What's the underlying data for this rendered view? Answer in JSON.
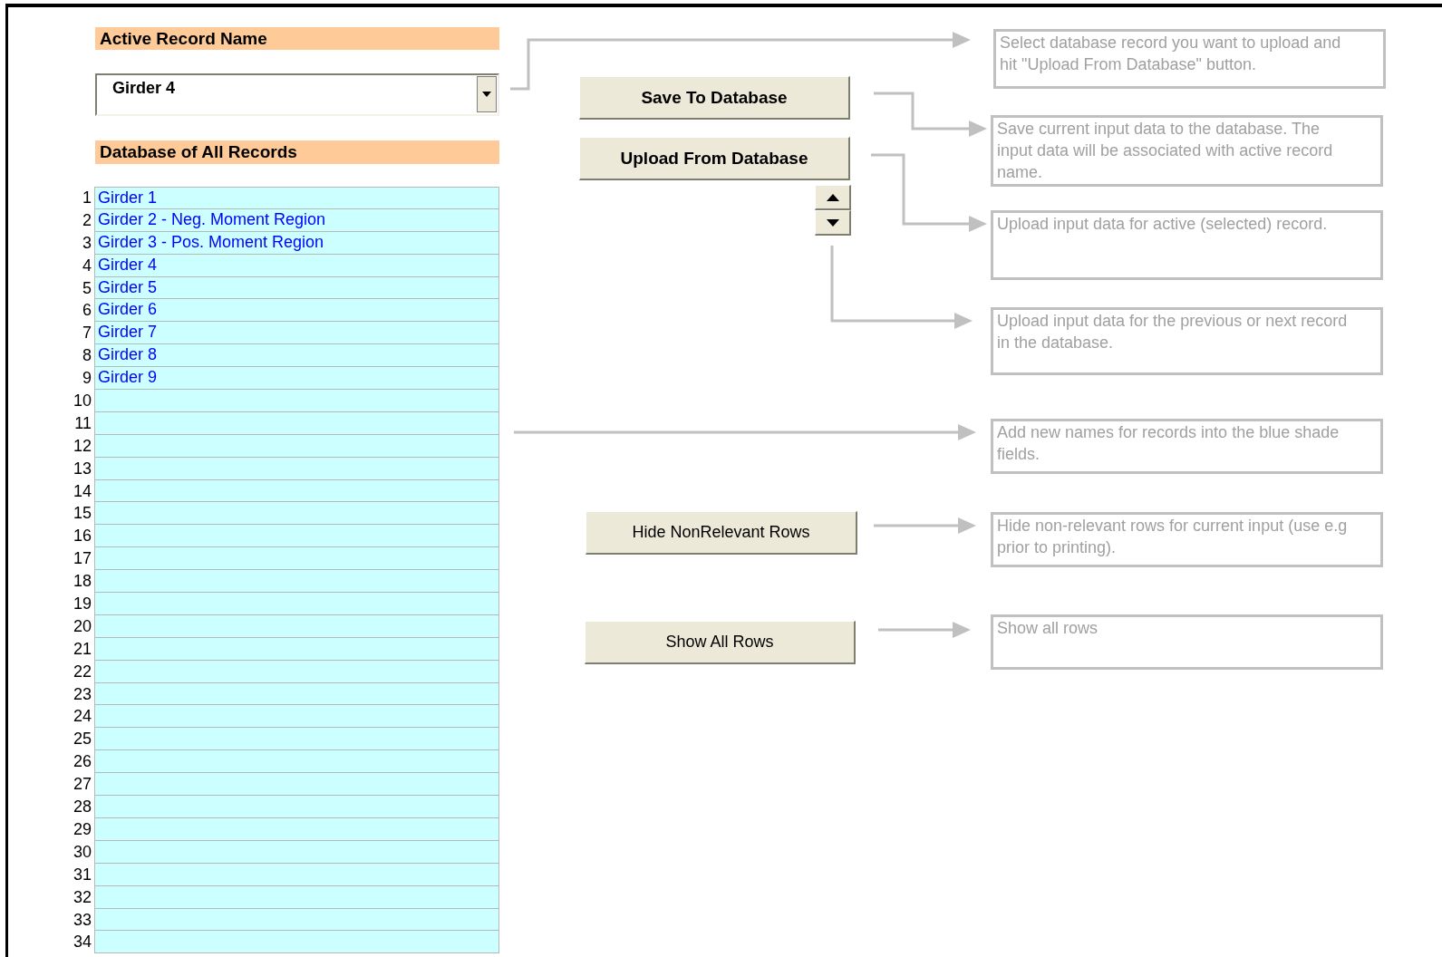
{
  "active_record": {
    "label": "Active Record Name",
    "value": "Girder 4"
  },
  "database": {
    "label": "Database of All Records",
    "rows": [
      {
        "number": "1",
        "name": "Girder 1"
      },
      {
        "number": "2",
        "name": "Girder 2 - Neg. Moment Region"
      },
      {
        "number": "3",
        "name": "Girder 3 - Pos. Moment Region"
      },
      {
        "number": "4",
        "name": "Girder 4"
      },
      {
        "number": "5",
        "name": "Girder 5"
      },
      {
        "number": "6",
        "name": "Girder 6"
      },
      {
        "number": "7",
        "name": "Girder 7"
      },
      {
        "number": "8",
        "name": "Girder 8"
      },
      {
        "number": "9",
        "name": "Girder 9"
      },
      {
        "number": "10"
      },
      {
        "number": "11"
      },
      {
        "number": "12"
      },
      {
        "number": "13"
      },
      {
        "number": "14"
      },
      {
        "number": "15"
      },
      {
        "number": "16"
      },
      {
        "number": "17"
      },
      {
        "number": "18"
      },
      {
        "number": "19"
      },
      {
        "number": "20"
      },
      {
        "number": "21"
      },
      {
        "number": "22"
      },
      {
        "number": "23"
      },
      {
        "number": "24"
      },
      {
        "number": "25"
      },
      {
        "number": "26"
      },
      {
        "number": "27"
      },
      {
        "number": "28"
      },
      {
        "number": "29"
      },
      {
        "number": "30"
      },
      {
        "number": "31"
      },
      {
        "number": "32"
      },
      {
        "number": "33"
      },
      {
        "number": "34"
      }
    ]
  },
  "buttons": [
    {
      "label": "Save To Database",
      "bold": true
    },
    {
      "label": "Upload From Database",
      "bold": true
    },
    {
      "label": "Hide NonRelevant Rows",
      "bold": false
    },
    {
      "label": "Show All Rows",
      "bold": false
    }
  ],
  "notes": [
    {
      "text": "Select database record you want to upload and\nhit \"Upload From Database\" button."
    },
    {
      "text": "Save current input data to the database. The\ninput data will be associated with active record\nname."
    },
    {
      "text": "Upload input data for active (selected) record."
    },
    {
      "text": "Upload input data for the previous or next record\nin the database."
    },
    {
      "text": "Add new names for records into the blue shade\nfields."
    },
    {
      "text": "Hide non-relevant rows for current input (use e.g\nprior to printing)."
    },
    {
      "text": "Show all rows"
    }
  ]
}
